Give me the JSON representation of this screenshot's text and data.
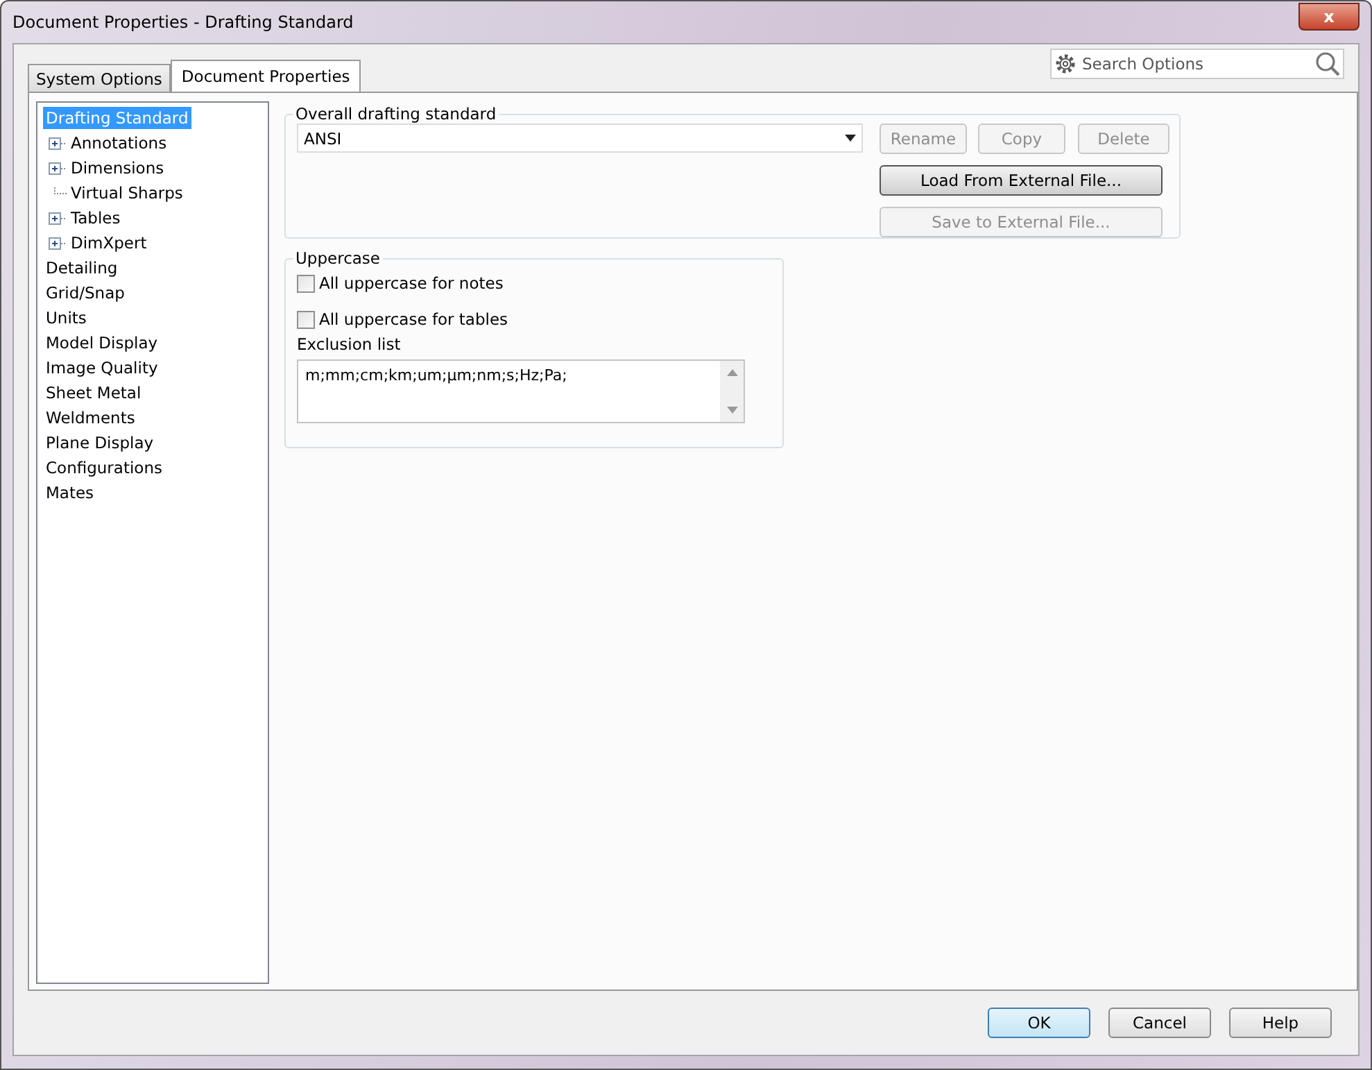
{
  "window": {
    "title": "Document Properties - Drafting Standard",
    "close_label": "x"
  },
  "tabs": [
    {
      "label": "System Options",
      "selected": false
    },
    {
      "label": "Document Properties",
      "selected": true
    }
  ],
  "search": {
    "placeholder": "Search Options"
  },
  "tree": [
    {
      "label": "Drafting Standard",
      "selected": true,
      "children": [
        {
          "label": "Annotations",
          "selected": false,
          "kind": "collapsed"
        },
        {
          "label": "Dimensions",
          "selected": false,
          "kind": "collapsed"
        },
        {
          "label": "Virtual Sharps",
          "selected": false,
          "kind": "leaf"
        },
        {
          "label": "Tables",
          "selected": false,
          "kind": "collapsed"
        },
        {
          "label": "DimXpert",
          "selected": false,
          "kind": "collapsed"
        }
      ]
    },
    {
      "label": "Detailing",
      "selected": false
    },
    {
      "label": "Grid/Snap",
      "selected": false
    },
    {
      "label": "Units",
      "selected": false
    },
    {
      "label": "Model Display",
      "selected": false
    },
    {
      "label": "Image Quality",
      "selected": false
    },
    {
      "label": "Sheet Metal",
      "selected": false
    },
    {
      "label": "Weldments",
      "selected": false
    },
    {
      "label": "Plane Display",
      "selected": false
    },
    {
      "label": "Configurations",
      "selected": false
    },
    {
      "label": "Mates",
      "selected": false
    }
  ],
  "drafting_standard": {
    "title": "Overall drafting standard",
    "value": "ANSI",
    "buttons": [
      {
        "label": "Rename",
        "disabled": true
      },
      {
        "label": "Copy",
        "disabled": true
      },
      {
        "label": "Delete",
        "disabled": true
      }
    ],
    "load_button": {
      "label": "Load From External File...",
      "disabled": false
    },
    "save_button": {
      "label": "Save to External File...",
      "disabled": true
    }
  },
  "uppercase": {
    "title": "Uppercase",
    "options": [
      {
        "label": "All uppercase for notes",
        "checked": false
      },
      {
        "label": "All uppercase for tables",
        "checked": false
      }
    ],
    "exclusion_label": "Exclusion list",
    "exclusion_value": "m;mm;cm;km;um;µm;nm;s;Hz;Pa;"
  },
  "footer_buttons": [
    {
      "label": "OK",
      "selected": true
    },
    {
      "label": "Cancel",
      "selected": false
    },
    {
      "label": "Help",
      "selected": false
    }
  ]
}
